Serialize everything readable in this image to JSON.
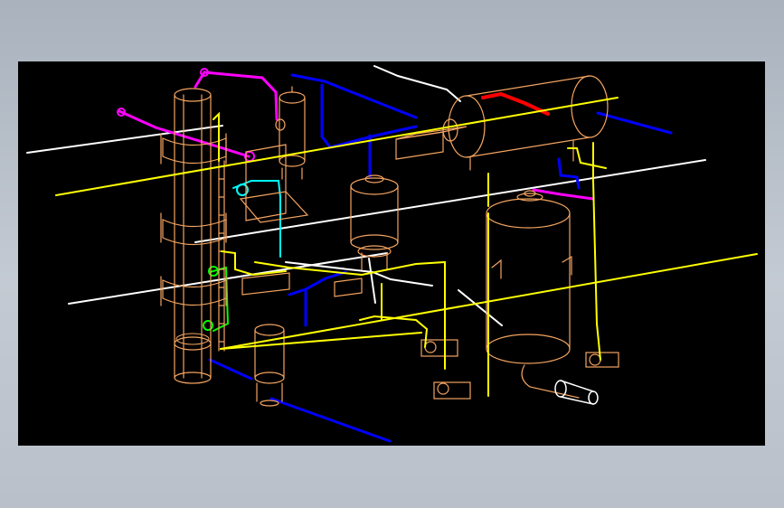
{
  "viewport": {
    "background": "#000000",
    "frame_color": "#b4bcc6"
  },
  "palette": {
    "equipment": "#f4a460",
    "process_line": "#ffff00",
    "utility_line": "#ffffff",
    "water_line": "#0000ff",
    "steam_line": "#ff00ff",
    "hot_line": "#ff0000",
    "cyan_line": "#00ffff",
    "green_line": "#00ff00"
  },
  "equipment": [
    {
      "id": "column-left",
      "type": "distillation-column"
    },
    {
      "id": "vessel-small-top",
      "type": "vertical-vessel"
    },
    {
      "id": "vessel-middle",
      "type": "vertical-vessel"
    },
    {
      "id": "vessel-small-bottom",
      "type": "vertical-vessel"
    },
    {
      "id": "drum-horizontal",
      "type": "horizontal-drum"
    },
    {
      "id": "tank-large",
      "type": "vertical-tank"
    },
    {
      "id": "pump-set",
      "type": "pump"
    }
  ]
}
